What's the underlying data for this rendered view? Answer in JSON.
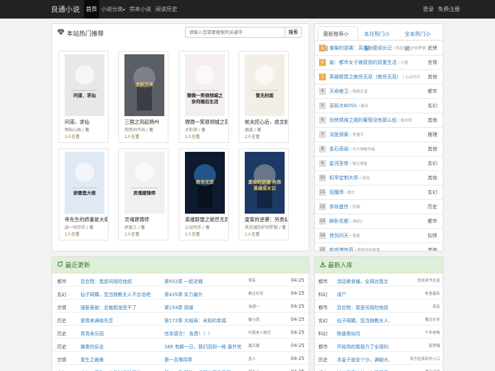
{
  "nav": {
    "brand": "良通小说",
    "items": [
      "首页",
      "小说分类",
      "完本小说",
      "阅读历史"
    ],
    "caret": "▾",
    "login": "登录",
    "register": "免费注册"
  },
  "hot": {
    "title": "本站热门推荐",
    "search_placeholder": "请输入您需要搜索的关键字",
    "search_button": "搜索",
    "books": [
      {
        "title": "问道，求仙",
        "author": "倒仙儿画 / 著",
        "readers": "1人在看",
        "cover_text": "问道．求仙",
        "cover_color": "#e8e8ea"
      },
      {
        "title": "三国之风起扬州",
        "author": "兜兜间不闲 / 著",
        "readers": "1人在看",
        "cover_text": "龙跃汉末",
        "cover_color": "#5a5f66"
      },
      {
        "title": "微微一笑很倾城之奈",
        "author": "王彩琦 / 著",
        "readers": "1人在看",
        "cover_text": "微微一笑很倾城之奈何婚后生活",
        "cover_color": "#f4eeee"
      },
      {
        "title": "前夫挖心后，虐文娇",
        "author": "烟波 / 著",
        "readers": "2人在看",
        "cover_text": "暂无封面",
        "cover_color": "#f3efe6"
      },
      {
        "title": "帝先生的娇妻是大佬",
        "author": "战一咕芬芬 / 著",
        "readers": "1人在看",
        "cover_text": "娇妻是大佬",
        "cover_color": "#dfe9f4"
      },
      {
        "title": "灵魂建铸师",
        "author": "虎爱三 / 著",
        "readers": "1人在看",
        "cover_text": "灵魂建铸师",
        "cover_color": "#eef0f2"
      },
      {
        "title": "英雄联盟之绝世无双",
        "author": "心动可乐 / 著",
        "readers": "1人在看",
        "cover_text": "绝世无双",
        "cover_color": "#0e1a2e"
      },
      {
        "title": "废柴的逆袭：另类劫",
        "author": "风花城的护剑罗锅 / 著",
        "readers": "1人在看",
        "cover_text": "废柴的逆袭 另类英雄成长记",
        "cover_color": "#1d3a66"
      }
    ]
  },
  "ranking": {
    "tabs": [
      "最新推荐小说",
      "本月热门小说",
      "全本热门小说"
    ],
    "items": [
      {
        "rank": "1",
        "name": "废柴的逆袭：另类劫便成长记",
        "author": "/ 风花城的护剑罗锅",
        "category": "武侠"
      },
      {
        "rank": "2",
        "name": "偷：都市女子被窥视的双重生活",
        "author": "/ 小雪",
        "category": "言情"
      },
      {
        "rank": "3",
        "name": "英雄联盟之绝世无双（绝世无双）",
        "author": "/ 心动可乐",
        "category": "其他"
      },
      {
        "rank": "4",
        "name": "天命绝卫",
        "author": "/ 明朗无语",
        "category": "都市"
      },
      {
        "rank": "5",
        "name": "巫妖大BOSS",
        "author": "/ 霸泽",
        "category": "玄幻"
      },
      {
        "rank": "6",
        "name": "剑侠情缘之我的葡萄没有那么低",
        "author": "/ 凯向阳",
        "category": "其他"
      },
      {
        "rank": "7",
        "name": "法医探案",
        "author": "/ 李捷平",
        "category": "推理"
      },
      {
        "rank": "8",
        "name": "金石奇闻",
        "author": "/ 东方神秘学者",
        "category": "其他"
      },
      {
        "rank": "9",
        "name": "星河圣帝",
        "author": "/ 鲁幻想鱼",
        "category": "玄幻"
      },
      {
        "rank": "10",
        "name": "机甲定制大师",
        "author": "/ 别羽",
        "category": "其他"
      },
      {
        "rank": "11",
        "name": "驭魔师",
        "author": "/ 郡大",
        "category": "玄幻"
      },
      {
        "rank": "12",
        "name": "崇祯盛世",
        "author": "/ 轩锋",
        "category": "历史"
      },
      {
        "rank": "13",
        "name": "醉卧花都",
        "author": "/ 神初2",
        "category": "都市"
      },
      {
        "rank": "14",
        "name": "侠剑问天",
        "author": "/ 意墨",
        "category": "仙侠"
      },
      {
        "rank": "15",
        "name": "新攻瑰传奇",
        "author": "/ 我喜欢的厨落",
        "category": "其他"
      }
    ]
  },
  "updates": {
    "title": "最近更新",
    "rows": [
      {
        "category": "都市",
        "name": "百合院：我是司雨柱他叔",
        "chapter": "第932章 一起进城",
        "author": "良有",
        "date": "04-25"
      },
      {
        "category": "玄幻",
        "name": "仙子网購，您当她教夫人不合适吧",
        "chapter": "第435章 实力暴升",
        "author": "枫过长安",
        "date": "04-25"
      },
      {
        "category": "言情",
        "name": "强娶豪娘：总裁超宠受不了",
        "chapter": "第154章 阴谋",
        "author": "浊酒一",
        "date": "04-25"
      },
      {
        "category": "历史",
        "name": "爱情来满烙先至",
        "chapter": "第172章 大结局：未知的幸福",
        "author": "猫小就",
        "date": "04-25"
      },
      {
        "category": "历史",
        "name": "青青朱乐回",
        "chapter": "完本感言！ 免费！！！",
        "author": "叫我老人欲巴",
        "date": "04-25"
      },
      {
        "category": "历史",
        "name": "嫌妻的反击",
        "chapter": "168 有朝一日，我们回到一格 番外完",
        "author": "嘉贝展",
        "date": "04-25"
      },
      {
        "category": "言情",
        "name": "重生之晨桑",
        "chapter": "第一百零四章",
        "author": "孟人",
        "date": "04-25"
      },
      {
        "category": "玄幻",
        "name": "玄幻：无敌，从复制经验开始!",
        "chapter": "第975章 下注三千万枚下品灵石",
        "author": "风九元",
        "date": "04-25"
      }
    ]
  },
  "newbooks": {
    "title": "最新入库",
    "rows": [
      {
        "category": "都市",
        "name": "流动美食辅，全网对我叉",
        "author": "剑说读书太诺"
      },
      {
        "category": "科幻",
        "name": "谍尸",
        "author": "老张者民"
      },
      {
        "category": "都市",
        "name": "百合院：我是司雨柱他叔",
        "author": "良有"
      },
      {
        "category": "玄幻",
        "name": "仙子网購，您当她教夫人...",
        "author": "枫过长安"
      },
      {
        "category": "科幻",
        "name": "陈雄秦如月",
        "author": "千年老龟"
      },
      {
        "category": "都市",
        "name": "开始场的我替力了全球的...",
        "author": "变梦烟"
      },
      {
        "category": "历史",
        "name": "本皇子就坐个沙，满朝大...",
        "author": "百方在该名作入口"
      },
      {
        "category": "都市",
        "name": "渣父子靠边站，女强王后...",
        "author": "满天迷星"
      }
    ]
  }
}
